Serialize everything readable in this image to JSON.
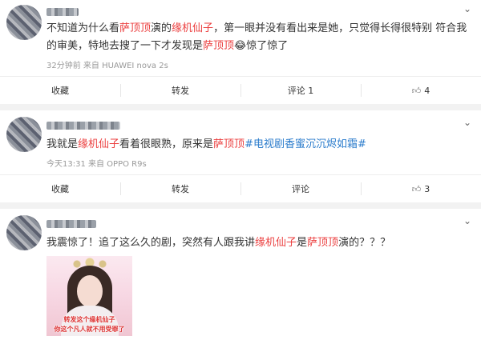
{
  "posts": [
    {
      "text": [
        {
          "t": "不知道为什么看",
          "c": ""
        },
        {
          "t": "萨顶顶",
          "c": "hl"
        },
        {
          "t": "演的",
          "c": ""
        },
        {
          "t": "缘机仙子",
          "c": "hl"
        },
        {
          "t": "，第一眼并没有看出来是她，只觉得长得很特别 符合我的审美，特地去搜了一下才发现是",
          "c": ""
        },
        {
          "t": "萨顶顶",
          "c": "hl"
        },
        {
          "t": "😂惊了惊了",
          "c": ""
        }
      ],
      "meta": "32分钟前 来自 HUAWEI nova 2s",
      "actions": {
        "collect": "收藏",
        "repost": "转发",
        "comment": "评论 1",
        "likes": "4"
      }
    },
    {
      "text": [
        {
          "t": "我就是",
          "c": ""
        },
        {
          "t": "缘机仙子",
          "c": "hl"
        },
        {
          "t": "看着很眼熟，原来是",
          "c": ""
        },
        {
          "t": "萨顶顶",
          "c": "hl"
        },
        {
          "t": "#电视剧香蜜沉沉烬如霜#",
          "c": "tag"
        }
      ],
      "meta": "今天13:31 来自 OPPO R9s",
      "actions": {
        "collect": "收藏",
        "repost": "转发",
        "comment": "评论",
        "likes": "3"
      }
    },
    {
      "text": [
        {
          "t": "我震惊了！追了这么久的剧，突然有人跟我讲",
          "c": ""
        },
        {
          "t": "缘机仙子",
          "c": "hl"
        },
        {
          "t": "是",
          "c": ""
        },
        {
          "t": "萨顶顶",
          "c": "hl"
        },
        {
          "t": "演的？？？",
          "c": ""
        }
      ],
      "image_caption": [
        "转发这个缘机仙子",
        "你这个凡人就不用受罪了"
      ]
    }
  ],
  "icons": {
    "chevron": "chevron-down-icon",
    "like": "thumb-up-icon"
  },
  "colors": {
    "highlight": "#eb3f3f",
    "hashtag": "#2b7ccc",
    "meta": "#999999"
  }
}
